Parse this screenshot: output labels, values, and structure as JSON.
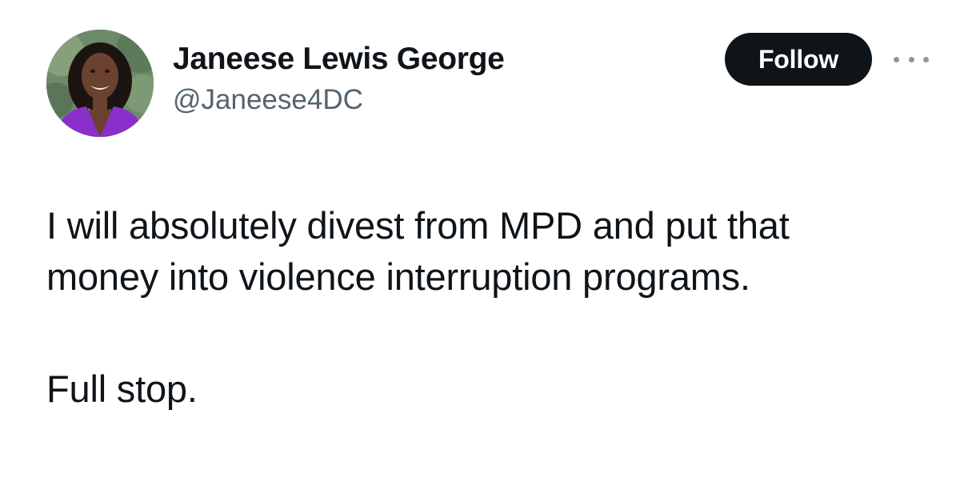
{
  "author": {
    "display_name": "Janeese Lewis George",
    "handle": "@Janeese4DC",
    "avatar_icon": "profile-photo"
  },
  "actions": {
    "follow_label": "Follow",
    "more_icon": "more-options-icon"
  },
  "tweet": {
    "line_1": "I will absolutely divest from MPD and put that",
    "line_2": "money into violence interruption programs.",
    "line_3": "Full stop."
  },
  "colors": {
    "text_primary": "#0f1419",
    "text_secondary": "#536471",
    "button_bg": "#0f1419",
    "button_text": "#ffffff"
  }
}
